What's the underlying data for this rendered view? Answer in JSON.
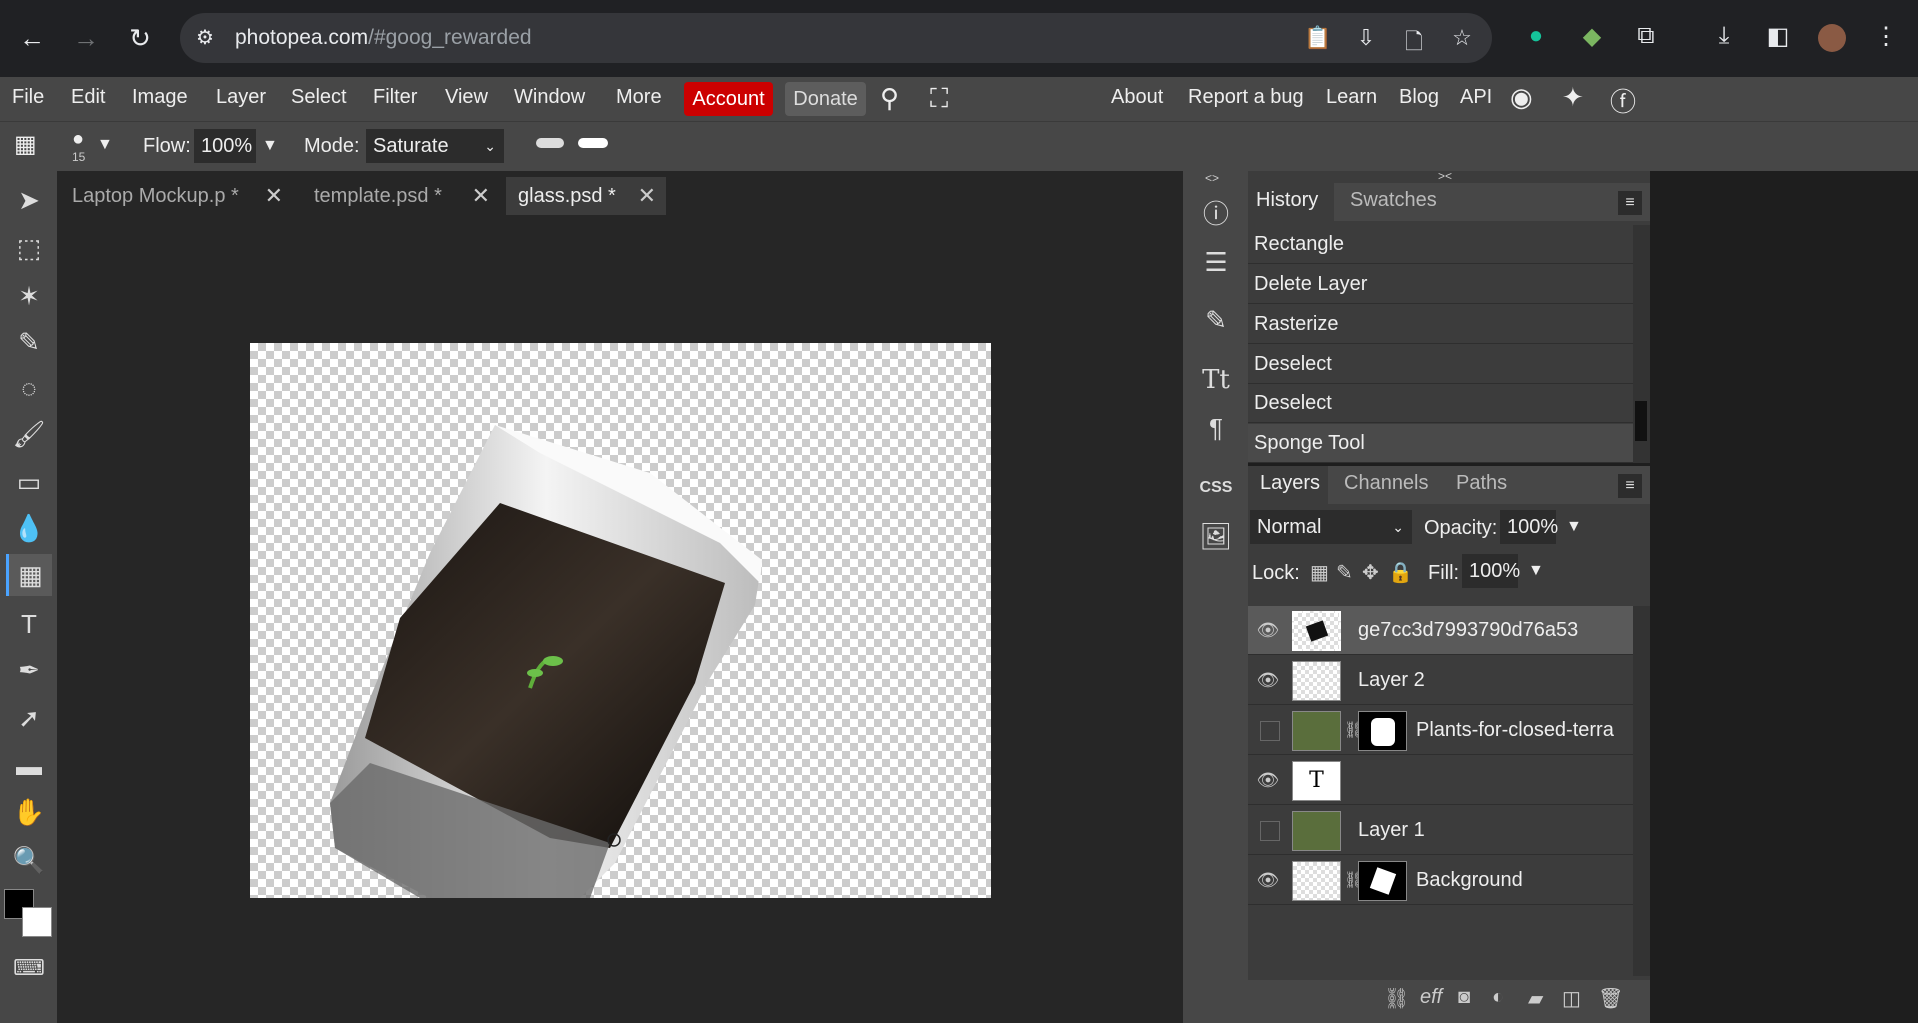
{
  "browser": {
    "url_host": "photopea.com",
    "url_path": "/#goog_rewarded"
  },
  "menu": {
    "file": "File",
    "edit": "Edit",
    "image": "Image",
    "layer": "Layer",
    "select": "Select",
    "filter": "Filter",
    "view": "View",
    "window": "Window",
    "more": "More",
    "account": "Account",
    "donate": "Donate",
    "about": "About",
    "report_bug": "Report a bug",
    "learn": "Learn",
    "blog": "Blog",
    "api": "API"
  },
  "options": {
    "brush_size": "15",
    "flow_label": "Flow:",
    "flow_value": "100%",
    "mode_label": "Mode:",
    "mode_value": "Saturate"
  },
  "tabs": [
    {
      "label": "Laptop Mockup.p *"
    },
    {
      "label": "template.psd *"
    },
    {
      "label": "glass.psd *"
    }
  ],
  "history_panel": {
    "tab_history": "History",
    "tab_swatches": "Swatches",
    "items": [
      "Rectangle",
      "Delete Layer",
      "Rasterize",
      "Deselect",
      "Deselect",
      "Sponge Tool"
    ]
  },
  "layers_panel": {
    "tab_layers": "Layers",
    "tab_channels": "Channels",
    "tab_paths": "Paths",
    "blend_mode": "Normal",
    "opacity_label": "Opacity:",
    "opacity_value": "100%",
    "lock_label": "Lock:",
    "fill_label": "Fill:",
    "fill_value": "100%",
    "layers": [
      {
        "name": "ge7cc3d7993790d76a53",
        "visible": true
      },
      {
        "name": "Layer 2",
        "visible": true
      },
      {
        "name": "Plants-for-closed-terra",
        "visible": false
      },
      {
        "name": "T",
        "visible": true
      },
      {
        "name": "Layer 1",
        "visible": false
      },
      {
        "name": "Background",
        "visible": true
      }
    ]
  },
  "colors": {
    "accent_account": "#cc0000",
    "active_tool_marker": "#4aa3ff"
  }
}
